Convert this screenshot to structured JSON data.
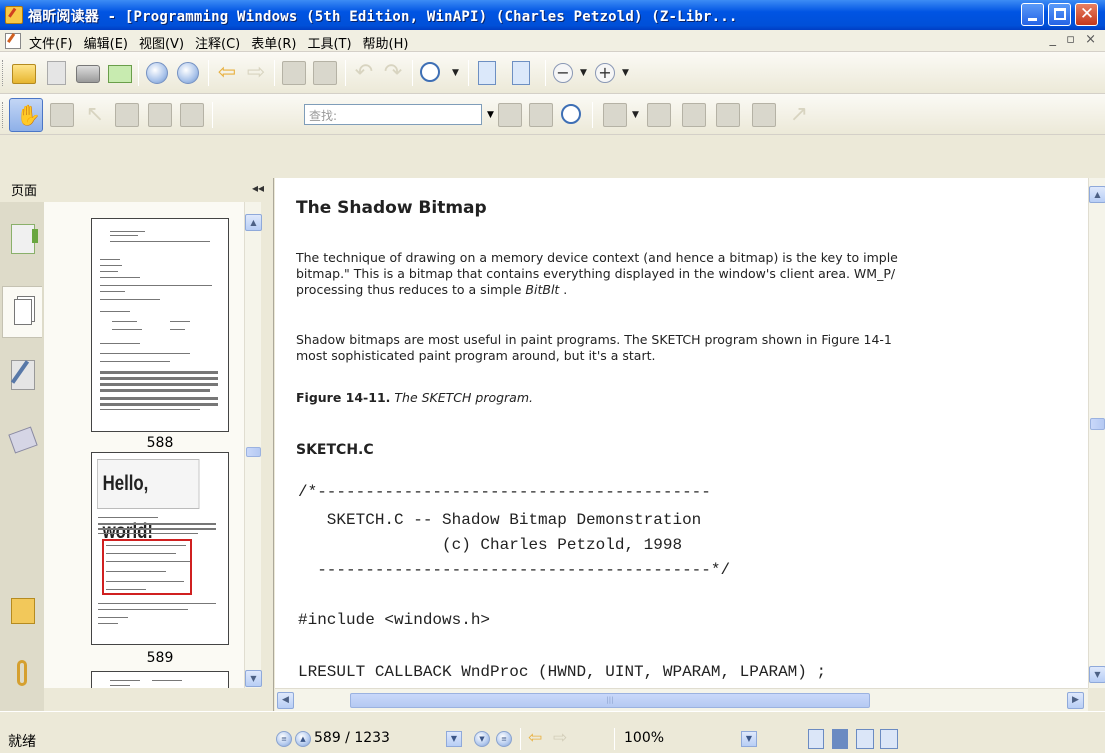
{
  "window": {
    "title": "福昕阅读器 - [Programming Windows (5th Edition, WinAPI) (Charles Petzold) (Z-Libr..."
  },
  "menu": {
    "items": [
      "文件(F)",
      "编辑(E)",
      "视图(V)",
      "注释(C)",
      "表单(R)",
      "工具(T)",
      "帮助(H)"
    ],
    "mdi_controls": "_ ▫ ×"
  },
  "toolbar": {
    "search_placeholder": "查找:"
  },
  "left_panel": {
    "title": "页面",
    "collapse": "◂◂",
    "thumbnails": [
      {
        "page_label": "588"
      },
      {
        "page_label": "589",
        "heading": "Hello, world!"
      }
    ]
  },
  "document": {
    "heading": "The Shadow Bitmap",
    "paragraph1": [
      "The technique of drawing on a memory device context (and hence a bitmap) is the key to imple",
      "bitmap.\" This is a bitmap that contains everything displayed in the window's client area. WM_P/",
      "processing thus reduces to a simple "
    ],
    "paragraph1_italic": "BitBlt",
    "paragraph1_end": " .",
    "paragraph2": [
      "Shadow bitmaps are most useful in paint programs. The SKETCH program shown in Figure 14-1",
      "most sophisticated paint program around, but it's a start."
    ],
    "figure_label": "Figure 14-11.",
    "figure_caption": "The SKETCH program.",
    "file_heading": "SKETCH.C",
    "code": [
      "/*-----------------------------------------",
      "   SKETCH.C -- Shadow Bitmap Demonstration",
      "               (c) Charles Petzold, 1998",
      "  -----------------------------------------*/",
      "#include <windows.h>",
      "LRESULT CALLBACK WndProc (HWND, UINT, WPARAM, LPARAM) ;"
    ]
  },
  "status": {
    "text": "就绪",
    "page": "589 / 1233",
    "zoom": "100%"
  },
  "colors": {
    "titlebar": "#0054e3",
    "chrome": "#ece9d8",
    "thumbnail_highlight": "#d02020"
  }
}
